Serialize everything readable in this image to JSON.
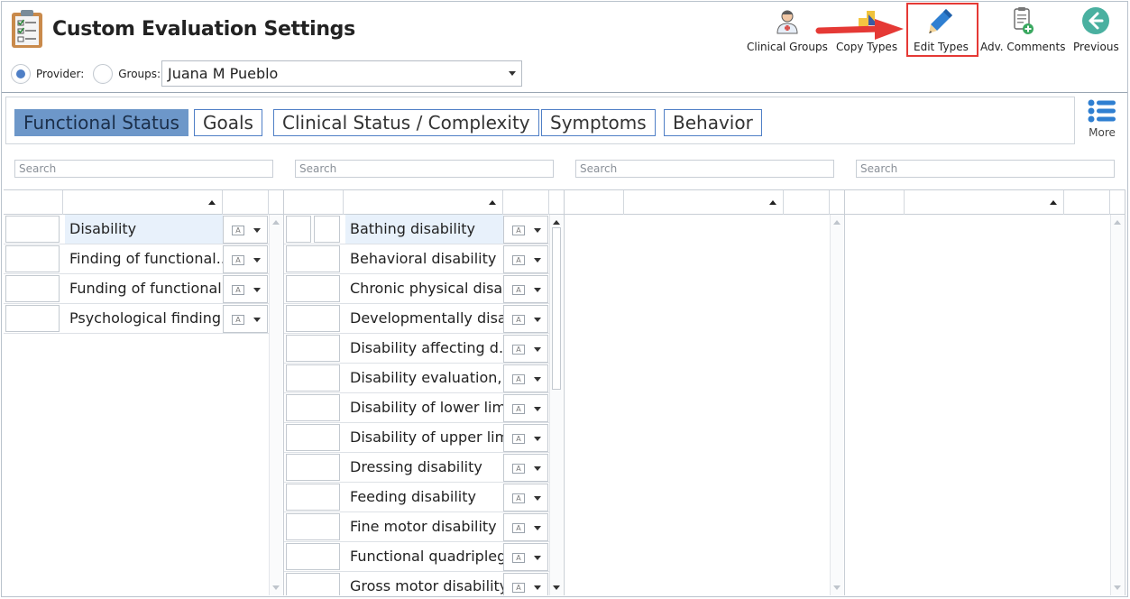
{
  "header": {
    "title": "Custom Evaluation Settings",
    "provider_label": "Provider:",
    "groups_label": "Groups:",
    "selected_provider": "Juana M Pueblo"
  },
  "toolbar": [
    {
      "id": "clinical-groups",
      "label": "Clinical Groups",
      "icon": "user-nurse-icon"
    },
    {
      "id": "copy-types",
      "label": "Copy Types",
      "icon": "copy-types-icon"
    },
    {
      "id": "edit-types",
      "label": "Edit Types",
      "icon": "pencil-icon"
    },
    {
      "id": "adv-comments",
      "label": "Adv. Comments",
      "icon": "clipboard-plus-icon"
    },
    {
      "id": "previous",
      "label": "Previous",
      "icon": "arrow-left-circle-icon"
    }
  ],
  "tabs": [
    {
      "label": "Functional Status",
      "active": true
    },
    {
      "label": "Goals",
      "active": false
    },
    {
      "label": "Clinical Status / Complexity",
      "active": false
    },
    {
      "label": "Symptoms",
      "active": false
    },
    {
      "label": "Behavior",
      "active": false
    }
  ],
  "more_label": "More",
  "search_placeholder": "Search",
  "type_button_glyph": "A",
  "grids": [
    {
      "rows": [
        "Disability",
        "Finding of functional...",
        "Funding of functional...",
        "Psychological finding"
      ]
    },
    {
      "rows": [
        "Bathing disability",
        "Behavioral disability",
        "Chronic physical disa...",
        "Developmentally disa...",
        "Disability  affecting d...",
        "Disability evaluation,...",
        "Disability of lower limb",
        "Disability of upper limb",
        "Dressing disability",
        "Feeding disability",
        "Fine motor disability",
        "Functional quadriplegia",
        "Gross motor disability"
      ]
    },
    {
      "rows": []
    },
    {
      "rows": []
    }
  ],
  "colors": {
    "active_tab": "#6d97c9",
    "tab_border": "#4f7fc6",
    "highlight": "#e53935",
    "selected_row": "#e8f1fb"
  }
}
